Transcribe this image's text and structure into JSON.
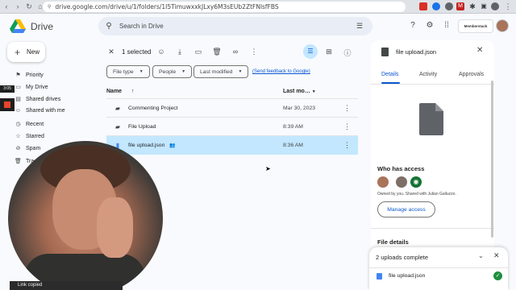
{
  "browser": {
    "url": "drive.google.com/drive/u/1/folders/1I5TimuwxxkJLxy6M3sEUb2ZtFNlsfFBS",
    "extensions": [
      {
        "icon": "red-extension-icon",
        "color": "#d93025"
      },
      {
        "icon": "m-extension-icon",
        "color": "#c5221f"
      },
      {
        "icon": "puzzle-icon",
        "color": "#5f6368"
      },
      {
        "icon": "profile-icon",
        "color": "#5f6368"
      }
    ]
  },
  "header": {
    "brand": "Drive",
    "search_placeholder": "Search in Drive",
    "org_badge": "Memberstack"
  },
  "sidebar": {
    "new_label": "New",
    "items": [
      {
        "icon": "flag-icon",
        "label": "Priority"
      },
      {
        "icon": "my-drive-icon",
        "label": "My Drive"
      },
      {
        "icon": "shared-drives-icon",
        "label": "Shared drives"
      },
      {
        "icon": "shared-with-me-icon",
        "label": "Shared with me"
      },
      {
        "icon": "clock-icon",
        "label": "Recent"
      },
      {
        "icon": "star-icon",
        "label": "Starred"
      },
      {
        "icon": "spam-icon",
        "label": "Spam"
      },
      {
        "icon": "trash-icon",
        "label": "Tra"
      }
    ]
  },
  "toolbar": {
    "selected_count": "1 selected"
  },
  "filters": {
    "chips": [
      "File type",
      "People",
      "Last modified"
    ],
    "feedback_link": "(Send feedback to Google)"
  },
  "list": {
    "columns": {
      "name": "Name",
      "modified": "Last mo…"
    },
    "rows": [
      {
        "name": "Commenting Project",
        "modified": "Mar 30, 2023",
        "type": "shared-folder",
        "selected": false
      },
      {
        "name": "File Upload",
        "modified": "8:39 AM",
        "type": "shared-folder",
        "selected": false
      },
      {
        "name": "file upload.json",
        "modified": "8:36 AM",
        "type": "file",
        "shared": true,
        "selected": true
      }
    ]
  },
  "details": {
    "title": "file upload.json",
    "tabs": [
      "Details",
      "Activity",
      "Approvals"
    ],
    "active_tab": "Details",
    "who_has_access": "Who has access",
    "owned_by": "Owned by you. Shared with Julian Galluzzo.",
    "manage_access": "Manage access",
    "file_details": "File details"
  },
  "uploads": {
    "title": "2 uploads complete",
    "file_name": "file upload.json"
  },
  "overlay": {
    "timer": "3:05",
    "toast": "Link copied"
  },
  "colors": {
    "accent": "#0b57d0",
    "selected_row": "#c2e7ff",
    "success": "#1e8e3e"
  }
}
